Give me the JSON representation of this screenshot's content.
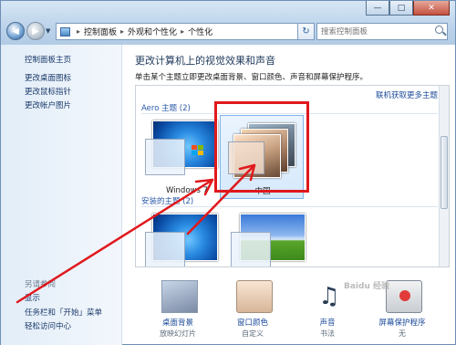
{
  "window": {
    "minimize": "—",
    "maximize": "□",
    "close": "✕"
  },
  "nav": {
    "dropdown": "▼",
    "breadcrumb": [
      "控制面板",
      "外观和个性化",
      "个性化"
    ],
    "breadcrumb_separator": "▸",
    "refresh": "↻",
    "search_placeholder": "搜索控制面板"
  },
  "sidebar": {
    "items": [
      {
        "label": "控制面板主页"
      },
      {
        "label": "更改桌面图标"
      },
      {
        "label": "更改鼠标指针"
      },
      {
        "label": "更改帐户图片"
      }
    ],
    "see_also": "另请参阅",
    "bottom_items": [
      {
        "label": "显示"
      },
      {
        "label": "任务栏和「开始」菜单"
      },
      {
        "label": "轻松访问中心"
      }
    ]
  },
  "main": {
    "title": "更改计算机上的视觉效果和声音",
    "subtitle": "单击某个主题立即更改桌面背景、窗口颜色、声音和屏幕保护程序。",
    "online_link": "联机获取更多主题",
    "aero_group": "Aero 主题 (2)",
    "basic_group": "安装的主题 (2)",
    "themes": [
      {
        "label": "Windows 7"
      },
      {
        "label": "中国"
      },
      {
        "label": ""
      },
      {
        "label": ""
      }
    ]
  },
  "tiles": [
    {
      "name": "桌面背景",
      "value": "放映幻灯片",
      "icon": "desktop-background-icon"
    },
    {
      "name": "窗口颜色",
      "value": "自定义",
      "icon": "window-color-icon"
    },
    {
      "name": "声音",
      "value": "书法",
      "icon": "sound-icon"
    },
    {
      "name": "屏幕保护程序",
      "value": "无",
      "icon": "screensaver-icon"
    }
  ],
  "watermark": "Baidu 经验",
  "colors": {
    "accent_link": "#1a4a99",
    "highlight_box": "#e0181c",
    "title_blue": "#1e395b"
  }
}
